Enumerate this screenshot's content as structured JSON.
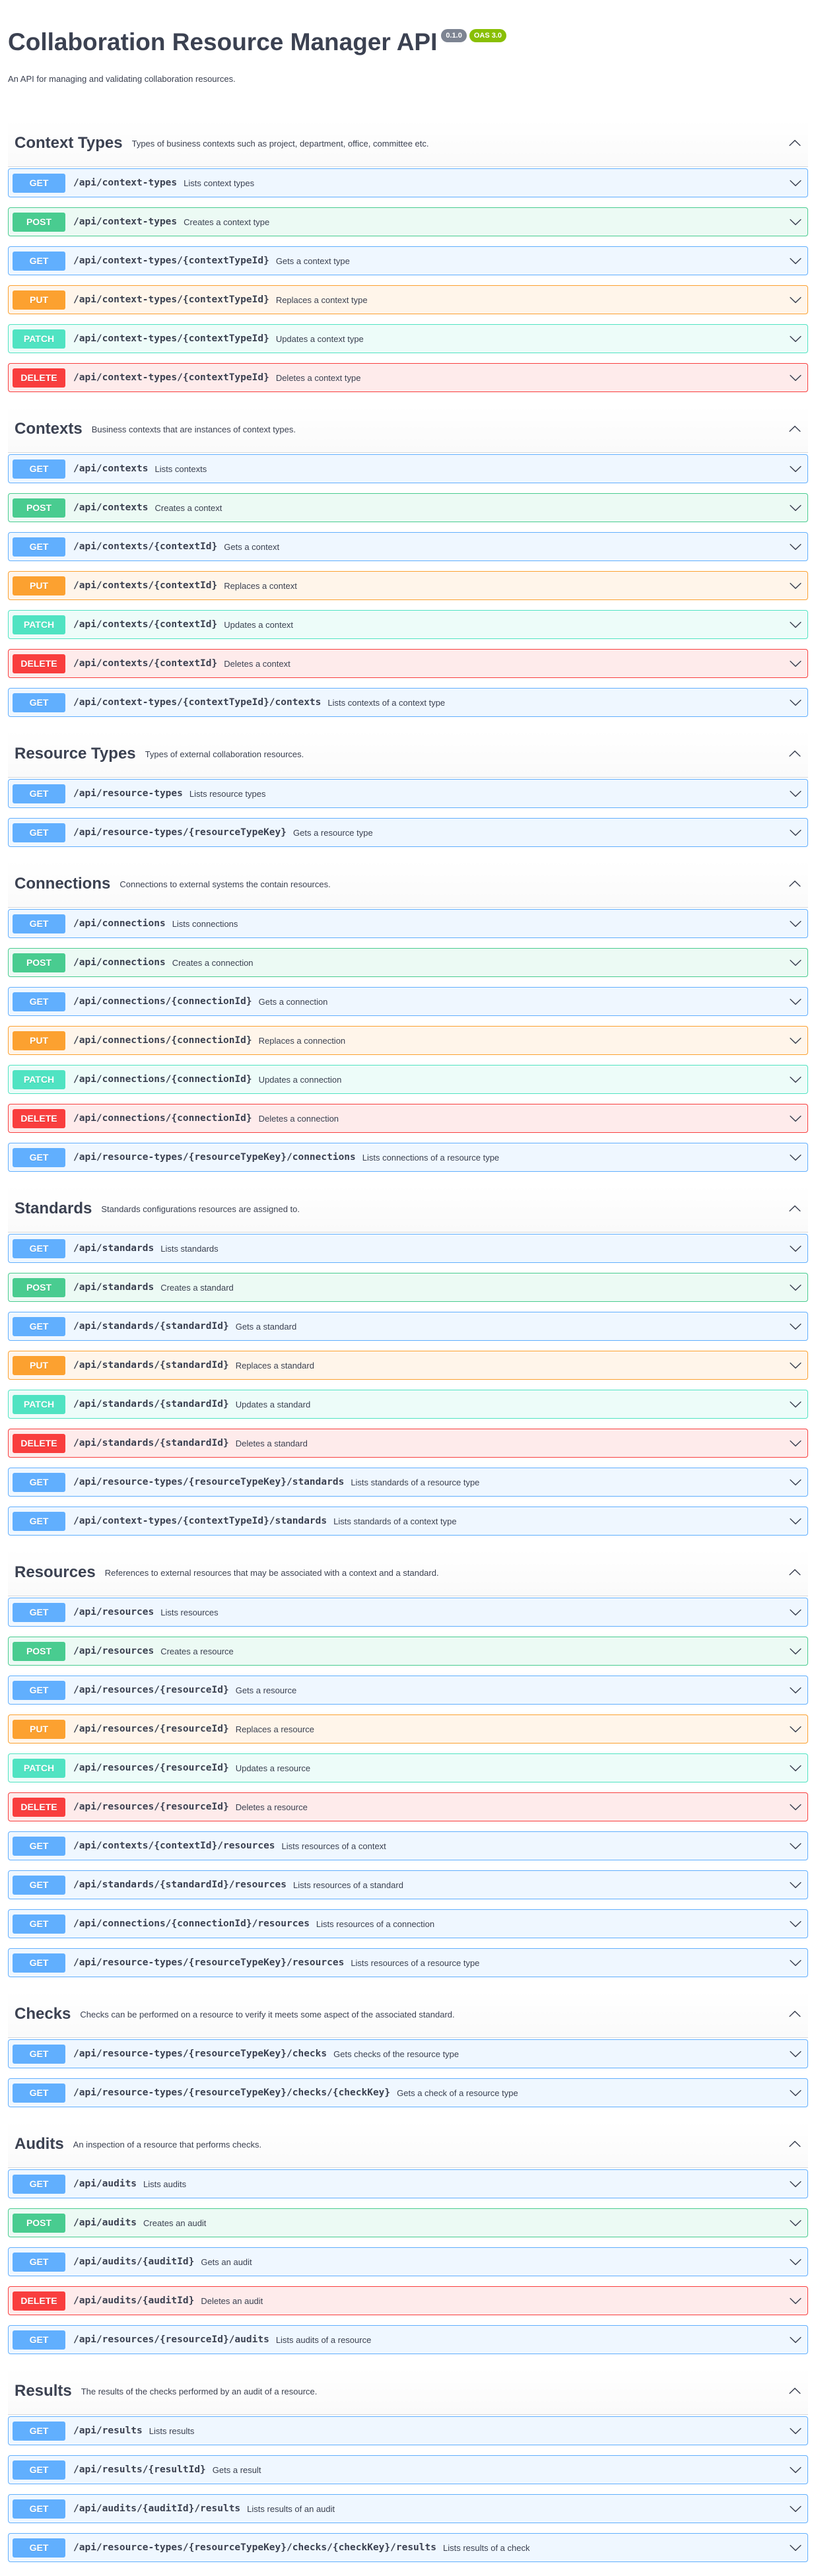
{
  "info": {
    "title": "Collaboration Resource Manager API",
    "version": "0.1.0",
    "oas": "OAS 3.0",
    "description": "An API for managing and validating collaboration resources."
  },
  "colors": {
    "get": "#61affe",
    "post": "#49cc90",
    "put": "#fca130",
    "patch": "#50e3c2",
    "delete": "#f93e3e"
  },
  "tags": [
    {
      "name": "Context Types",
      "description": "Types of business contexts such as project, department, office, committee etc.",
      "expanded_icon": "chevron-up-icon",
      "ops": [
        {
          "method": "GET",
          "path": "/api/context-types",
          "summary": "Lists context types"
        },
        {
          "method": "POST",
          "path": "/api/context-types",
          "summary": "Creates a context type"
        },
        {
          "method": "GET",
          "path": "/api/context-types/{contextTypeId}",
          "summary": "Gets a context type"
        },
        {
          "method": "PUT",
          "path": "/api/context-types/{contextTypeId}",
          "summary": "Replaces a context type"
        },
        {
          "method": "PATCH",
          "path": "/api/context-types/{contextTypeId}",
          "summary": "Updates a context type"
        },
        {
          "method": "DELETE",
          "path": "/api/context-types/{contextTypeId}",
          "summary": "Deletes a context type"
        }
      ]
    },
    {
      "name": "Contexts",
      "description": "Business contexts that are instances of context types.",
      "ops": [
        {
          "method": "GET",
          "path": "/api/contexts",
          "summary": "Lists contexts"
        },
        {
          "method": "POST",
          "path": "/api/contexts",
          "summary": "Creates a context"
        },
        {
          "method": "GET",
          "path": "/api/contexts/{contextId}",
          "summary": "Gets a context"
        },
        {
          "method": "PUT",
          "path": "/api/contexts/{contextId}",
          "summary": "Replaces a context"
        },
        {
          "method": "PATCH",
          "path": "/api/contexts/{contextId}",
          "summary": "Updates a context"
        },
        {
          "method": "DELETE",
          "path": "/api/contexts/{contextId}",
          "summary": "Deletes a context"
        },
        {
          "method": "GET",
          "path": "/api/context-types/{contextTypeId}/contexts",
          "summary": "Lists contexts of a context type"
        }
      ]
    },
    {
      "name": "Resource Types",
      "description": "Types of external collaboration resources.",
      "ops": [
        {
          "method": "GET",
          "path": "/api/resource-types",
          "summary": "Lists resource types"
        },
        {
          "method": "GET",
          "path": "/api/resource-types/{resourceTypeKey}",
          "summary": "Gets a resource type"
        }
      ]
    },
    {
      "name": "Connections",
      "description": "Connections to external systems the contain resources.",
      "ops": [
        {
          "method": "GET",
          "path": "/api/connections",
          "summary": "Lists connections"
        },
        {
          "method": "POST",
          "path": "/api/connections",
          "summary": "Creates a connection"
        },
        {
          "method": "GET",
          "path": "/api/connections/{connectionId}",
          "summary": "Gets a connection"
        },
        {
          "method": "PUT",
          "path": "/api/connections/{connectionId}",
          "summary": "Replaces a connection"
        },
        {
          "method": "PATCH",
          "path": "/api/connections/{connectionId}",
          "summary": "Updates a connection"
        },
        {
          "method": "DELETE",
          "path": "/api/connections/{connectionId}",
          "summary": "Deletes a connection"
        },
        {
          "method": "GET",
          "path": "/api/resource-types/{resourceTypeKey}/connections",
          "summary": "Lists connections of a resource type"
        }
      ]
    },
    {
      "name": "Standards",
      "description": "Standards configurations resources are assigned to.",
      "ops": [
        {
          "method": "GET",
          "path": "/api/standards",
          "summary": "Lists standards"
        },
        {
          "method": "POST",
          "path": "/api/standards",
          "summary": "Creates a standard"
        },
        {
          "method": "GET",
          "path": "/api/standards/{standardId}",
          "summary": "Gets a standard"
        },
        {
          "method": "PUT",
          "path": "/api/standards/{standardId}",
          "summary": "Replaces a standard"
        },
        {
          "method": "PATCH",
          "path": "/api/standards/{standardId}",
          "summary": "Updates a standard"
        },
        {
          "method": "DELETE",
          "path": "/api/standards/{standardId}",
          "summary": "Deletes a standard"
        },
        {
          "method": "GET",
          "path": "/api/resource-types/{resourceTypeKey}/standards",
          "summary": "Lists standards of a resource type"
        },
        {
          "method": "GET",
          "path": "/api/context-types/{contextTypeId}/standards",
          "summary": "Lists standards of a context type"
        }
      ]
    },
    {
      "name": "Resources",
      "description": "References to external resources that may be associated with a context and a standard.",
      "ops": [
        {
          "method": "GET",
          "path": "/api/resources",
          "summary": "Lists resources"
        },
        {
          "method": "POST",
          "path": "/api/resources",
          "summary": "Creates a resource"
        },
        {
          "method": "GET",
          "path": "/api/resources/{resourceId}",
          "summary": "Gets a resource"
        },
        {
          "method": "PUT",
          "path": "/api/resources/{resourceId}",
          "summary": "Replaces a resource"
        },
        {
          "method": "PATCH",
          "path": "/api/resources/{resourceId}",
          "summary": "Updates a resource"
        },
        {
          "method": "DELETE",
          "path": "/api/resources/{resourceId}",
          "summary": "Deletes a resource"
        },
        {
          "method": "GET",
          "path": "/api/contexts/{contextId}/resources",
          "summary": "Lists resources of a context"
        },
        {
          "method": "GET",
          "path": "/api/standards/{standardId}/resources",
          "summary": "Lists resources of a standard"
        },
        {
          "method": "GET",
          "path": "/api/connections/{connectionId}/resources",
          "summary": "Lists resources of a connection"
        },
        {
          "method": "GET",
          "path": "/api/resource-types/{resourceTypeKey}/resources",
          "summary": "Lists resources of a resource type"
        }
      ]
    },
    {
      "name": "Checks",
      "description": "Checks can be performed on a resource to verify it meets some aspect of the associated standard.",
      "ops": [
        {
          "method": "GET",
          "path": "/api/resource-types/{resourceTypeKey}/checks",
          "summary": "Gets checks of the resource type"
        },
        {
          "method": "GET",
          "path": "/api/resource-types/{resourceTypeKey}/checks/{checkKey}",
          "summary": "Gets a check of a resource type"
        }
      ]
    },
    {
      "name": "Audits",
      "description": "An inspection of a resource that performs checks.",
      "ops": [
        {
          "method": "GET",
          "path": "/api/audits",
          "summary": "Lists audits"
        },
        {
          "method": "POST",
          "path": "/api/audits",
          "summary": "Creates an audit"
        },
        {
          "method": "GET",
          "path": "/api/audits/{auditId}",
          "summary": "Gets an audit"
        },
        {
          "method": "DELETE",
          "path": "/api/audits/{auditId}",
          "summary": "Deletes an audit"
        },
        {
          "method": "GET",
          "path": "/api/resources/{resourceId}/audits",
          "summary": "Lists audits of a resource"
        }
      ]
    },
    {
      "name": "Results",
      "description": "The results of the checks performed by an audit of a resource.",
      "ops": [
        {
          "method": "GET",
          "path": "/api/results",
          "summary": "Lists results"
        },
        {
          "method": "GET",
          "path": "/api/results/{resultId}",
          "summary": "Gets a result"
        },
        {
          "method": "GET",
          "path": "/api/audits/{auditId}/results",
          "summary": "Lists results of an audit"
        },
        {
          "method": "GET",
          "path": "/api/resource-types/{resourceTypeKey}/checks/{checkKey}/results",
          "summary": "Lists results of a check"
        }
      ]
    }
  ]
}
